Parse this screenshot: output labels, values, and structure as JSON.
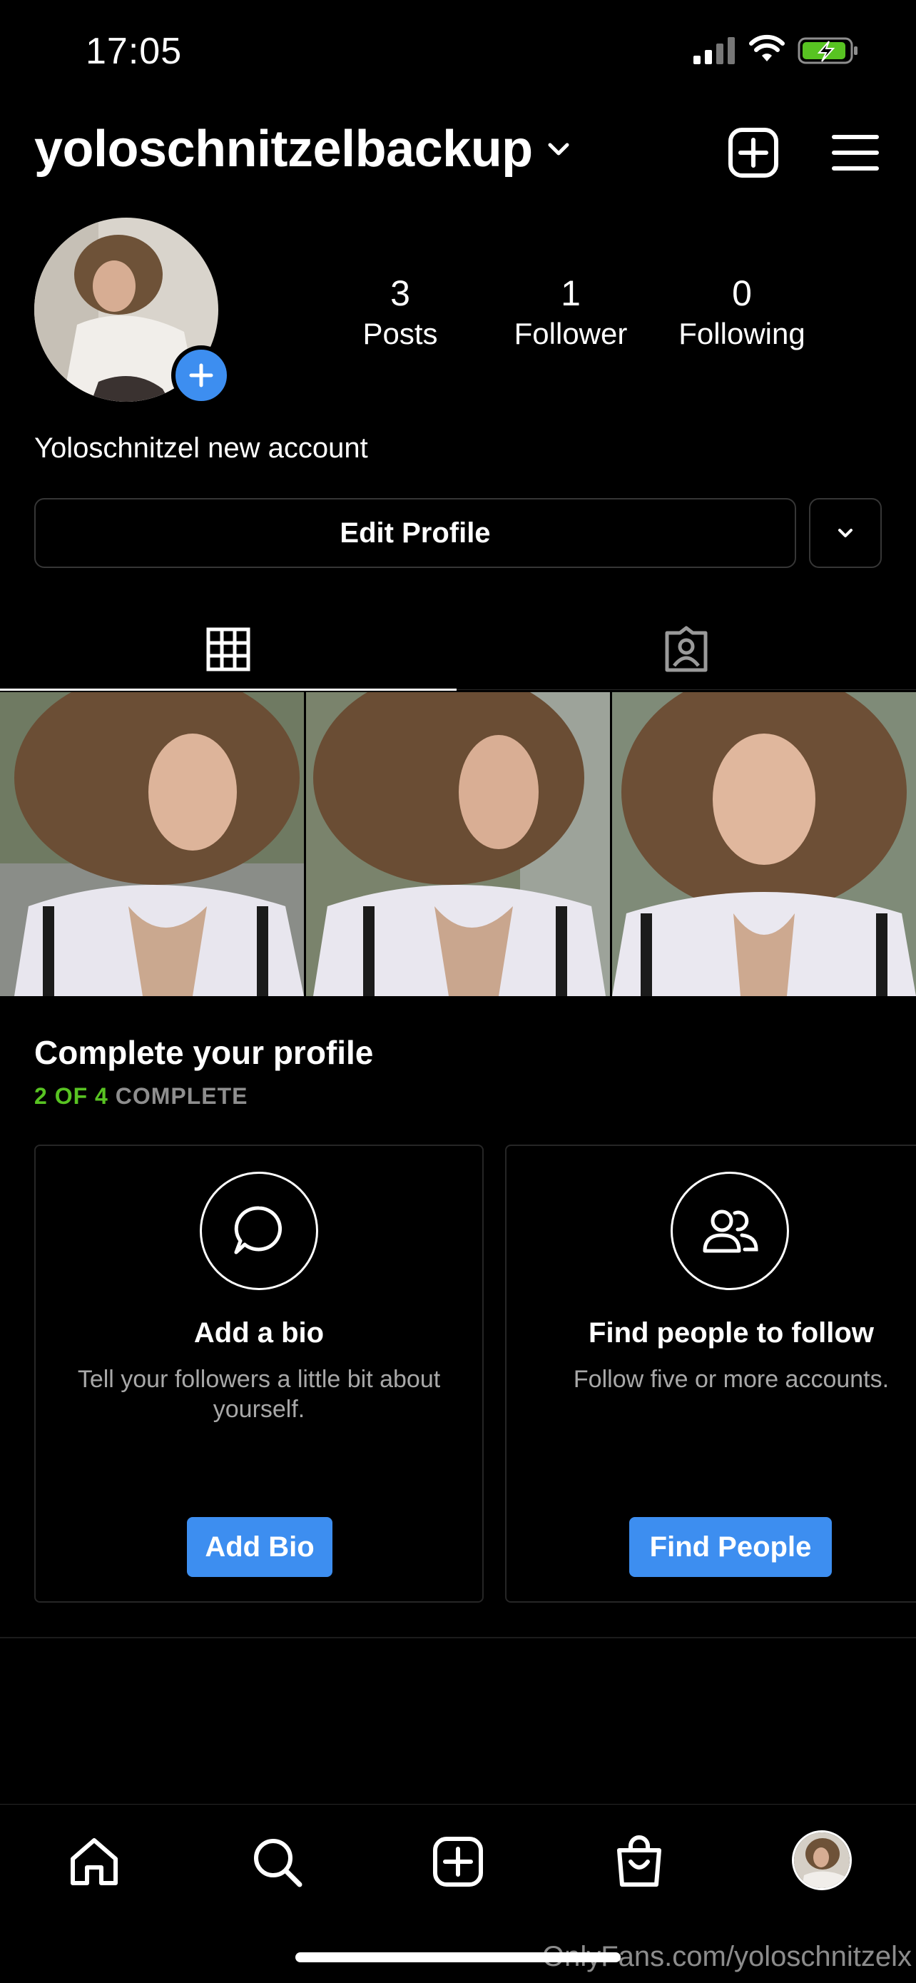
{
  "status_bar": {
    "time": "17:05",
    "icons": [
      "cellular-signal-icon",
      "wifi-icon",
      "battery-charging-icon"
    ]
  },
  "header": {
    "username": "yoloschnitzelbackup",
    "icons": [
      "chevron-down-icon",
      "new-post-icon",
      "menu-icon"
    ]
  },
  "profile": {
    "stats": [
      {
        "value": "3",
        "label": "Posts"
      },
      {
        "value": "1",
        "label": "Follower"
      },
      {
        "value": "0",
        "label": "Following"
      }
    ],
    "display_name": "Yoloschnitzel new account",
    "edit_label": "Edit Profile"
  },
  "tabs": [
    "grid-icon",
    "tagged-icon"
  ],
  "complete_profile": {
    "title": "Complete your profile",
    "progress_done": "2 OF 4",
    "progress_rest": "COMPLETE",
    "cards": [
      {
        "title": "Add a bio",
        "desc": "Tell your followers a little bit about yourself.",
        "button": "Add Bio",
        "icon": "speech-bubble-icon"
      },
      {
        "title": "Find people to follow",
        "desc": "Follow five or more accounts.",
        "button": "Find People",
        "icon": "people-icon"
      }
    ]
  },
  "bottom_nav": [
    "home-icon",
    "search-icon",
    "create-icon",
    "shop-icon",
    "profile-avatar"
  ],
  "watermark": "OnlyFans.com/yoloschnitzelx",
  "colors": {
    "accent": "#3d8ef0",
    "progress_done": "#58c322",
    "progress_rest": "#8e8e8e"
  }
}
